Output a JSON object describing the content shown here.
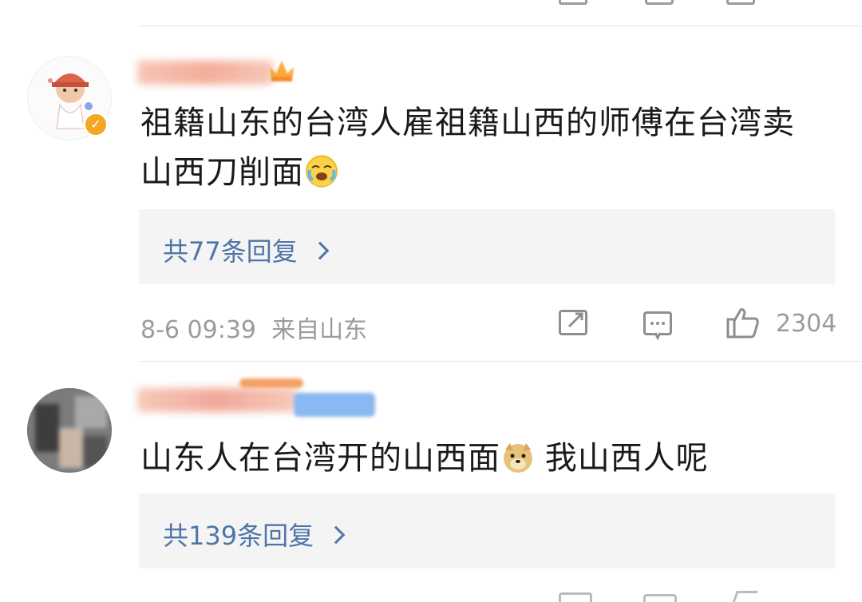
{
  "comments": [
    {
      "content": "祖籍山东的台湾人雇祖籍山西的师傅在台湾卖山西刀削面",
      "content_line1": "祖籍山东的台湾人雇祖籍山西的师傅在台湾卖",
      "content_line2": "山西刀削面",
      "emoji": "crying-laughing-emoji",
      "replies": "共77条回复",
      "time": "8-6 09:39",
      "source": "来自山东",
      "likes": "2304",
      "verified": true
    },
    {
      "content_part1": "山东人在台湾开的山西面",
      "emoji": "doge-emoji",
      "content_part2": " 我山西人呢",
      "replies": "共139条回复"
    }
  ],
  "colors": {
    "link": "#4f75a8",
    "meta": "#9b9b9b",
    "reply_bg": "#f4f4f4",
    "divider": "#e6e6e6",
    "badge": "#f5a623"
  }
}
